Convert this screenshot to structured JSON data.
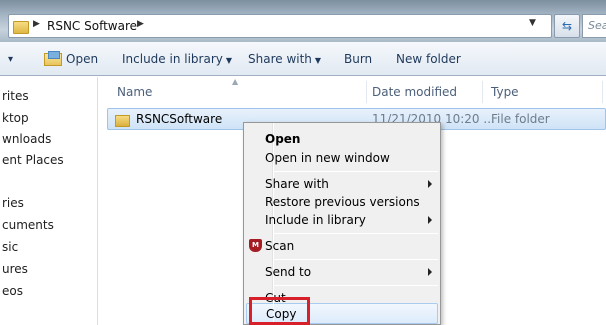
{
  "address_bar": {
    "path": "RSNC Software",
    "search_placeholder": "Search"
  },
  "toolbar": {
    "organize_arrow": "▾",
    "open_label": "Open",
    "include_label": "Include in library",
    "share_label": "Share with",
    "burn_label": "Burn",
    "new_folder_label": "New folder"
  },
  "nav": {
    "items": [
      "rites",
      "ktop",
      "wnloads",
      "ent Places",
      "ries",
      "cuments",
      "sic",
      "ures",
      "eos"
    ]
  },
  "columns": {
    "name": "Name",
    "date": "Date modified",
    "type": "Type"
  },
  "file": {
    "name": "RSNCSoftware",
    "date": "11/21/2010 10:20 ...",
    "type": "File folder"
  },
  "context_menu": {
    "open": "Open",
    "open_new_window": "Open in new window",
    "share_with": "Share with",
    "restore": "Restore previous versions",
    "include": "Include in library",
    "scan": "Scan",
    "send_to": "Send to",
    "cut": "Cut",
    "copy": "Copy"
  },
  "colors": {
    "highlight": "#d8202a",
    "selection": "#cfe3f7"
  }
}
